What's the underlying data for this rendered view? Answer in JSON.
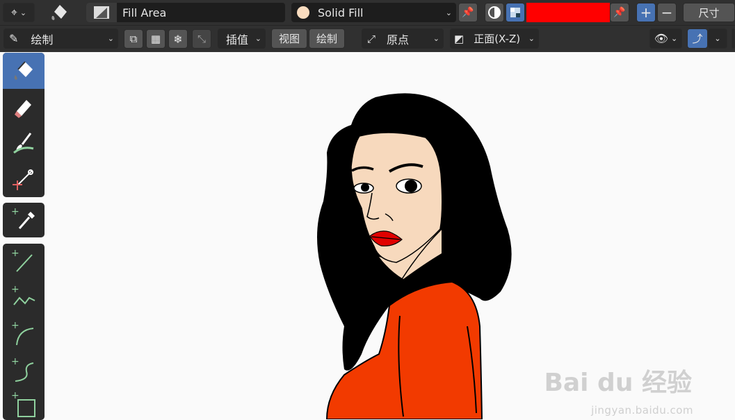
{
  "header": {
    "fill_mode_label": "Fill Area",
    "material_label": "Solid Fill",
    "color_hex": "#ff0000",
    "size_label": "尺寸",
    "plus_label": "+",
    "minus_label": "−"
  },
  "toolbar": {
    "mode_label": "绘制",
    "interpolate_label": "插值",
    "view_label": "视图",
    "draw_label": "绘制",
    "origin_label": "原点",
    "plane_label": "正面(X-Z)"
  },
  "tools": [
    {
      "name": "fill-tool",
      "icon": "bucket-icon"
    },
    {
      "name": "erase-tool",
      "icon": "eraser-icon"
    },
    {
      "name": "tint-tool",
      "icon": "brush-icon"
    },
    {
      "name": "cutter-tool",
      "icon": "scissors-icon"
    },
    {
      "name": "eyedropper-tool",
      "icon": "eyedropper-icon"
    },
    {
      "name": "line-tool",
      "icon": "line-icon"
    },
    {
      "name": "polyline-tool",
      "icon": "polyline-icon"
    },
    {
      "name": "arc-tool",
      "icon": "arc-icon"
    },
    {
      "name": "curve-tool",
      "icon": "curve-icon"
    },
    {
      "name": "box-tool",
      "icon": "box-icon"
    }
  ],
  "watermark": {
    "main": "Bai du 经验",
    "sub": "jingyan.baidu.com"
  }
}
